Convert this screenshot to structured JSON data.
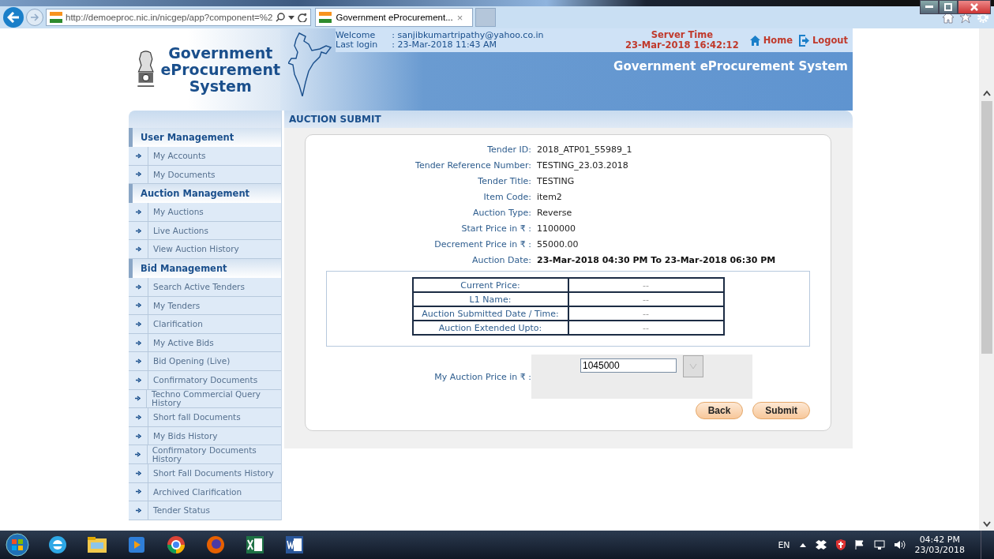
{
  "browser": {
    "address": "http://demoeproc.nic.in/nicgep/app?component=%2",
    "tab_title": "Government eProcurement...",
    "tab_close": "×"
  },
  "header": {
    "logo_lines": [
      "Government",
      "eProcurement",
      "System"
    ],
    "welcome_label": "Welcome",
    "welcome_value": ": sanjibkumartripathy@yahoo.co.in",
    "last_login_label": "Last login",
    "last_login_value": ": 23-Mar-2018 11:43 AM",
    "server_time_label": "Server Time",
    "server_time": "23-Mar-2018 16:42:12",
    "links": [
      {
        "kind": "home",
        "label": "Home"
      },
      {
        "kind": "logout",
        "label": "Logout"
      }
    ],
    "banner": "Government eProcurement System"
  },
  "sidebar": {
    "sections": [
      {
        "title": "User Management",
        "items": [
          "My Accounts",
          "My Documents"
        ]
      },
      {
        "title": "Auction Management",
        "items": [
          "My Auctions",
          "Live Auctions",
          "View Auction History"
        ]
      },
      {
        "title": "Bid Management",
        "items": [
          "Search Active Tenders",
          "My Tenders",
          "Clarification",
          "My Active Bids",
          "Bid Opening (Live)",
          "Confirmatory Documents",
          "Techno Commercial Query History",
          "Short fall Documents",
          "My Bids History",
          "Confirmatory Documents History",
          "Short Fall Documents History",
          "Archived Clarification",
          "Tender Status"
        ]
      }
    ]
  },
  "content": {
    "title": "AUCTION SUBMIT",
    "details": [
      {
        "label": "Tender ID:",
        "value": "2018_ATP01_55989_1",
        "bold": false
      },
      {
        "label": "Tender Reference Number:",
        "value": "TESTING_23.03.2018",
        "bold": false
      },
      {
        "label": "Tender Title:",
        "value": "TESTING",
        "bold": false
      },
      {
        "label": "Item Code:",
        "value": "item2",
        "bold": false
      },
      {
        "label": "Auction Type:",
        "value": "Reverse",
        "bold": false
      },
      {
        "label": "Start Price in ₹ :",
        "value": "1100000",
        "bold": false
      },
      {
        "label": "Decrement Price in ₹ :",
        "value": "55000.00",
        "bold": false
      },
      {
        "label": "Auction Date:",
        "value": "23-Mar-2018 04:30 PM To 23-Mar-2018 06:30 PM",
        "bold": true
      }
    ],
    "status_table": [
      {
        "label": "Current Price:",
        "value": "--"
      },
      {
        "label": "L1 Name:",
        "value": "--"
      },
      {
        "label": "Auction Submitted Date / Time:",
        "value": "--"
      },
      {
        "label": "Auction Extended Upto:",
        "value": "--"
      }
    ],
    "price_label": "My Auction Price in ₹ :",
    "price_value": "1045000",
    "buttons": [
      "Back",
      "Submit"
    ]
  },
  "taskbar": {
    "apps": [
      {
        "kind": "ie"
      },
      {
        "kind": "folder"
      },
      {
        "kind": "media"
      },
      {
        "kind": "chrome"
      },
      {
        "kind": "firefox"
      },
      {
        "kind": "excel"
      },
      {
        "kind": "word"
      }
    ],
    "language": "EN",
    "time": "04:42 PM",
    "date": "23/03/2018"
  }
}
